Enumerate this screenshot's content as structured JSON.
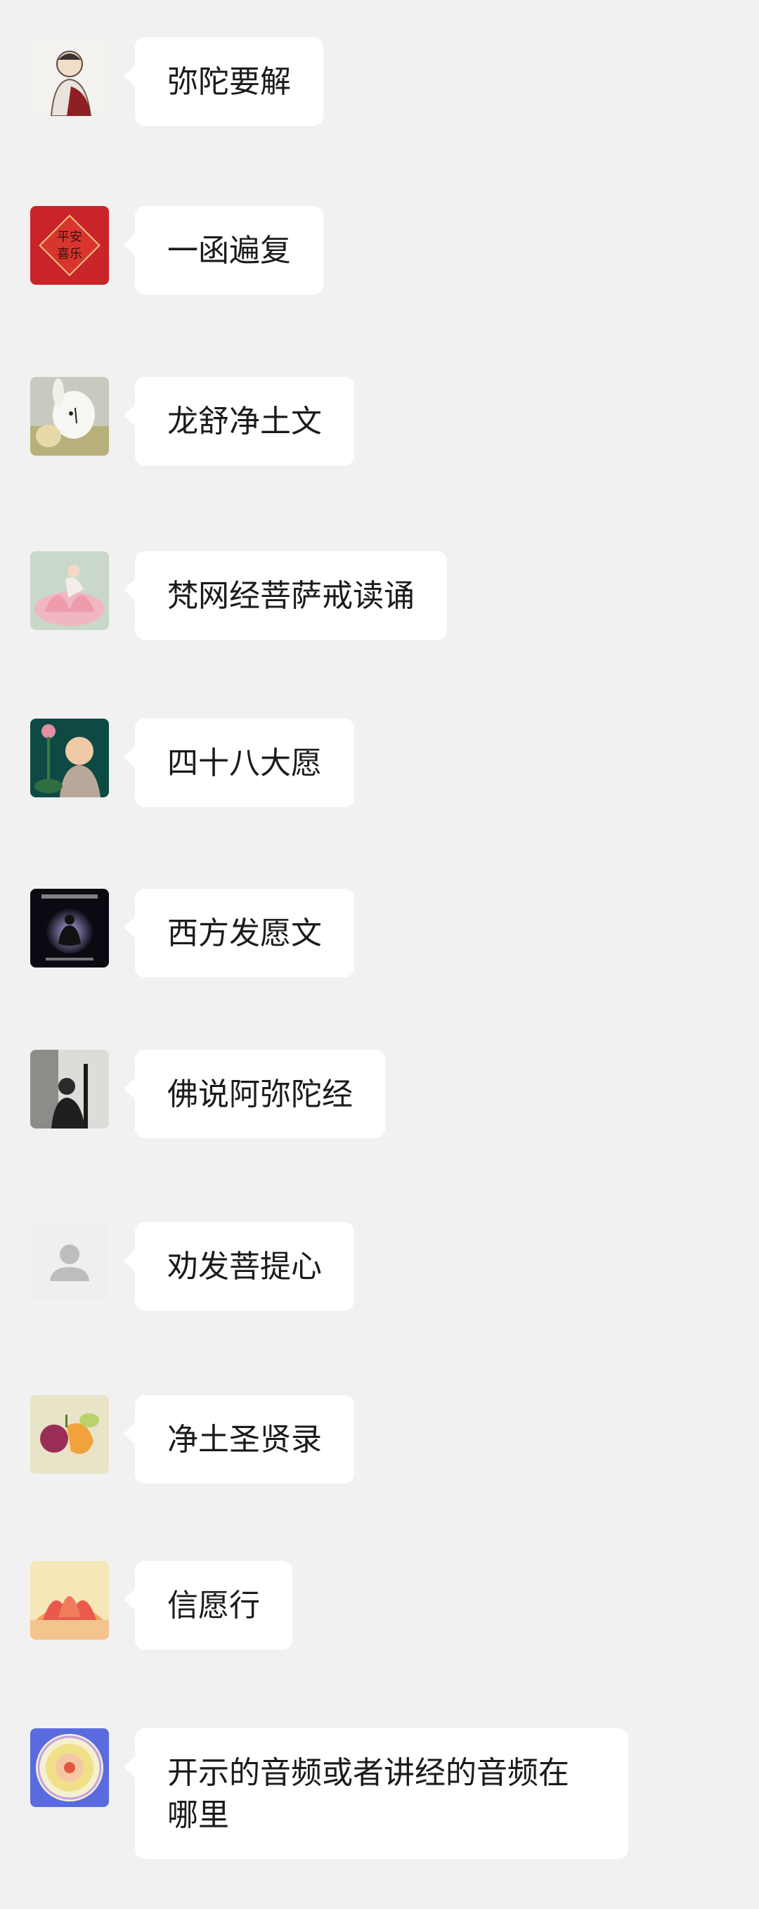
{
  "messages": [
    {
      "text": "弥陀要解",
      "avatar": "monk-drawing-avatar"
    },
    {
      "text": "一函遍复",
      "avatar": "red-fu-banner-avatar",
      "avatar_text_1": "平安",
      "avatar_text_2": "喜乐"
    },
    {
      "text": "龙舒净土文",
      "avatar": "plush-toy-avatar"
    },
    {
      "text": "梵网经菩萨戒读诵",
      "avatar": "lotus-fairy-avatar"
    },
    {
      "text": "四十八大愿",
      "avatar": "child-monk-avatar"
    },
    {
      "text": "西方发愿文",
      "avatar": "meditation-silhouette-avatar"
    },
    {
      "text": "佛说阿弥陀经",
      "avatar": "photo-person-avatar"
    },
    {
      "text": "劝发菩提心",
      "avatar": "default-user-avatar"
    },
    {
      "text": "净土圣贤录",
      "avatar": "fruit-avatar"
    },
    {
      "text": "信愿行",
      "avatar": "lotus-flower-avatar"
    },
    {
      "text": "开示的音频或者讲经的音频在哪里",
      "avatar": "mandala-avatar"
    }
  ],
  "colors": {
    "background": "#f1f1f1",
    "bubble": "#ffffff",
    "text": "#1b1b1b"
  }
}
